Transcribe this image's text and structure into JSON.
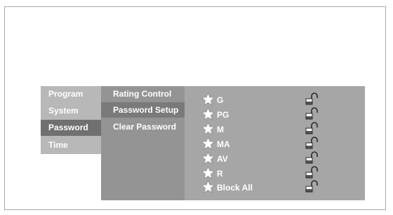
{
  "menu": {
    "categories": [
      {
        "label": "Program",
        "active": false
      },
      {
        "label": "System",
        "active": false
      },
      {
        "label": "Password",
        "active": true
      },
      {
        "label": "Time",
        "active": false
      }
    ],
    "submenu": [
      {
        "label": "Rating Control",
        "active": false
      },
      {
        "label": "Password Setup",
        "active": true
      },
      {
        "label": "Clear Password",
        "active": false
      }
    ],
    "ratings": [
      {
        "label": "G",
        "locked": false
      },
      {
        "label": "PG",
        "locked": false
      },
      {
        "label": "M",
        "locked": false
      },
      {
        "label": "MA",
        "locked": false
      },
      {
        "label": "AV",
        "locked": false
      },
      {
        "label": "R",
        "locked": false
      },
      {
        "label": "Block All",
        "locked": false
      }
    ]
  },
  "colors": {
    "category_bg": "#b8b8b8",
    "category_active_bg": "#707070",
    "submenu_bg": "#949494",
    "ratings_bg": "#a6a6a6",
    "text": "#ffffff"
  },
  "icons": {
    "rating_icon": "star-icon",
    "lock_icon": "unlocked-padlock-icon",
    "submenu_indicator": "arrow-right-icon"
  }
}
